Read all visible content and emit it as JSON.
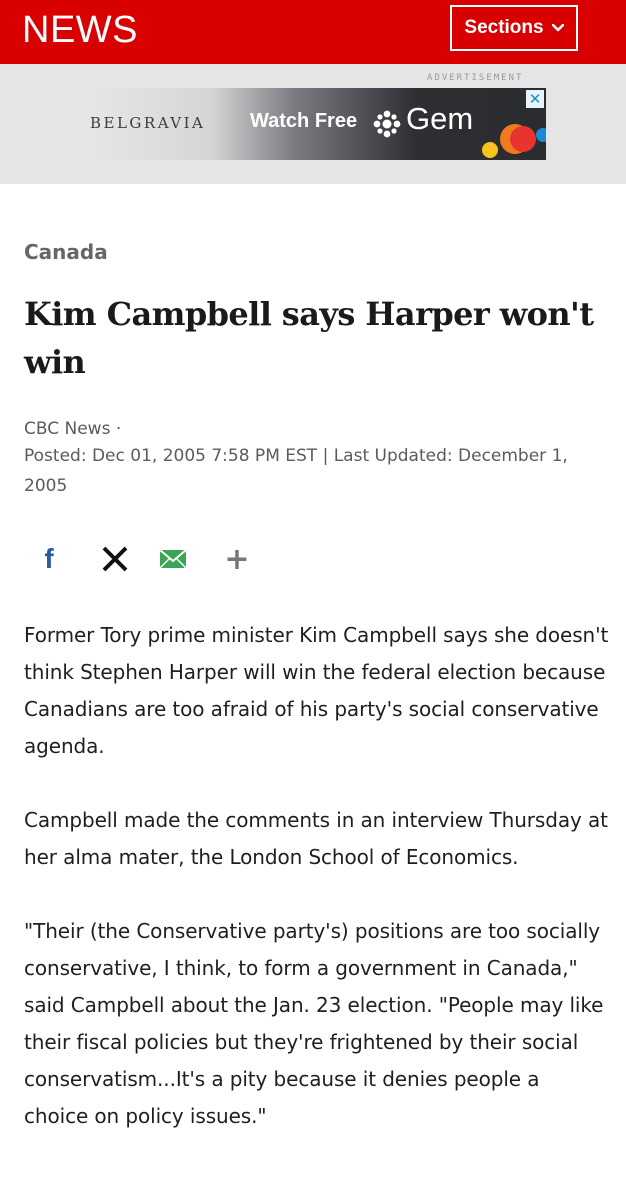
{
  "header": {
    "logo": "NEWS",
    "sections_label": "Sections"
  },
  "ad": {
    "label": "ADVERTISEMENT",
    "belgravia": "BELGRAVIA",
    "watch_free": "Watch Free",
    "gem": "Gem",
    "close_glyph": "✕"
  },
  "article": {
    "category": "Canada",
    "headline": "Kim Campbell says Harper won't win",
    "source": "CBC News ·",
    "dates": "Posted: Dec 01, 2005 7:58 PM EST | Last Updated: December 1, 2005",
    "paragraphs": [
      "Former Tory prime minister Kim Campbell says she doesn't think Stephen Harper will win the federal election because Canadians are too afraid of his party's social conservative agenda.",
      "Campbell made the comments in an interview Thursday at her alma mater, the London School of Economics.",
      "\"Their (the Conservative party's) positions are too socially conservative, I think, to form a government in Canada,\" said Campbell about the Jan. 23 election. \"People may like their fiscal policies but they're frightened by their social conservatism...It's a pity because it denies people a choice on policy issues.\""
    ]
  },
  "share": {
    "facebook_glyph": "f",
    "more_glyph": "+"
  },
  "colors": {
    "brand_red": "#d80000",
    "facebook_blue": "#2d5aa0",
    "email_green": "#3aa655"
  },
  "icons": [
    "chevron-down-icon",
    "close-icon",
    "cbc-gem-icon",
    "facebook-icon",
    "x-icon",
    "email-icon",
    "plus-icon"
  ]
}
